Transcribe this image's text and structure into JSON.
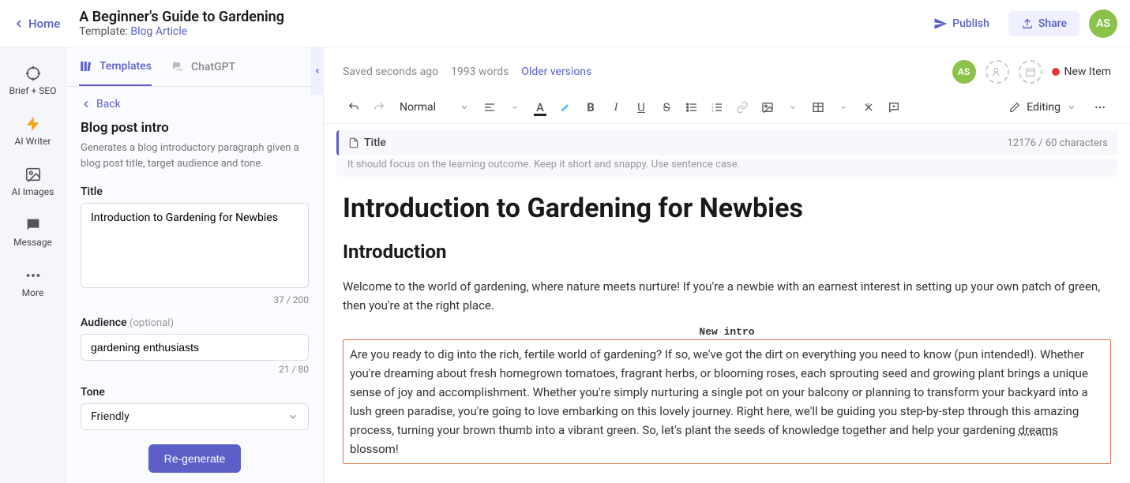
{
  "header": {
    "home": "Home",
    "title": "A Beginner's Guide to Gardening",
    "template_label": "Template:",
    "template_name": "Blog Article",
    "publish": "Publish",
    "share": "Share",
    "avatar": "AS"
  },
  "rail": {
    "brief": "Brief + SEO",
    "ai_writer": "AI Writer",
    "ai_images": "AI Images",
    "message": "Message",
    "more": "More"
  },
  "sidebar": {
    "tab_templates": "Templates",
    "tab_chatgpt": "ChatGPT",
    "back": "Back",
    "panel_title": "Blog post intro",
    "panel_desc": "Generates a blog introductory paragraph given a blog post title, target audience and tone.",
    "title_label": "Title",
    "title_value": "Introduction to Gardening for Newbies",
    "title_count": "37 / 200",
    "audience_label": "Audience",
    "audience_optional": "(optional)",
    "audience_value": "gardening enthusiasts",
    "audience_count": "21 / 80",
    "tone_label": "Tone",
    "tone_value": "Friendly",
    "regenerate": "Re-generate"
  },
  "editor": {
    "saved": "Saved seconds ago",
    "words": "1993 words",
    "older": "Older versions",
    "avatar": "AS",
    "status": "New Item",
    "style": "Normal",
    "editing": "Editing",
    "title_strip": "Title",
    "char_count": "12176 / 60 characters",
    "title_hint": "It should focus on the learning outcome. Keep it short and snappy. Use sentence case.",
    "h1": "Introduction to Gardening for Newbies",
    "h2": "Introduction",
    "para1": "Welcome to the world of gardening, where nature meets nurture! If you're a newbie with an earnest interest in setting up your own patch of green, then you're at the right place.",
    "new_intro_label": "New intro",
    "para2a": "Are you ready to dig into the rich, fertile world of gardening? If so, we've got the dirt on everything you need to know (pun intended!). Whether you're dreaming about fresh homegrown tomatoes, fragrant herbs, or blooming roses, each sprouting seed and growing plant brings a unique sense of joy and accomplishment. Whether you're simply nurturing a single pot on your balcony or planning to transform your backyard into a lush green paradise, you're going to love embarking on this lovely journey. Right here, we'll be guiding you step-by-step through this amazing process, turning your brown thumb into a vibrant green. So, let's plant the seeds of knowledge together and help your gardening ",
    "para2b": "dreams",
    "para2c": " blossom!"
  }
}
